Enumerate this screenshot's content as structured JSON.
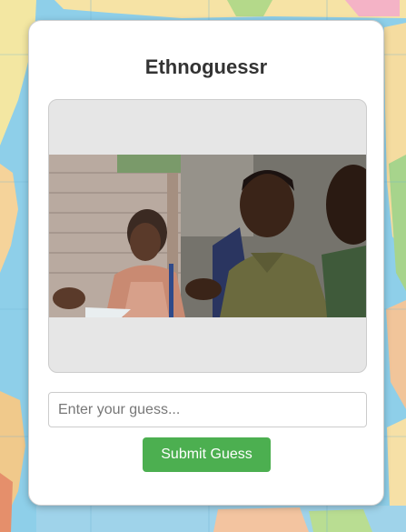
{
  "app": {
    "title": "Ethnoguessr"
  },
  "guess": {
    "placeholder": "Enter your guess...",
    "value": "",
    "submit_label": "Submit Guess"
  },
  "colors": {
    "accent": "#4caf50",
    "card_background": "#ffffff",
    "map_ocean": "#8ecfe9"
  }
}
